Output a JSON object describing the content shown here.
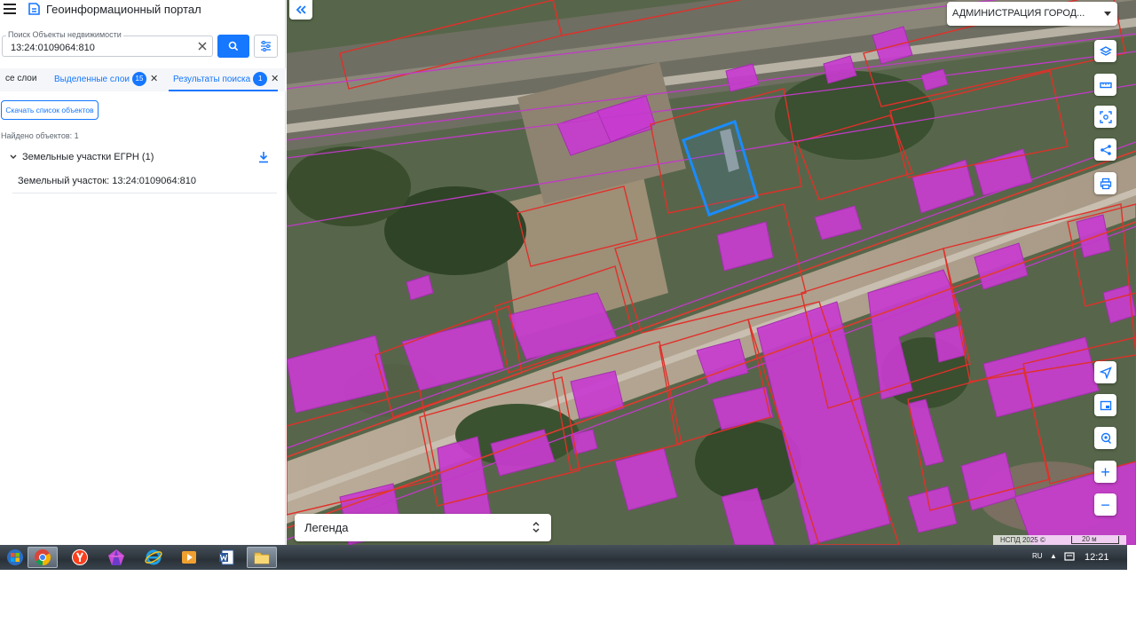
{
  "app": {
    "title": "Геоинформационный портал"
  },
  "search": {
    "label": "Поиск Объекты недвижимости",
    "value": "13:24:0109064:810"
  },
  "tabs": [
    {
      "label": "се слои"
    },
    {
      "label": "Выделенные слои",
      "count": "15"
    },
    {
      "label": "Результаты поиска",
      "count": "1"
    }
  ],
  "results": {
    "download_label": "Скачать список объектов",
    "found_label": "Найдено объектов: 1",
    "group_title": "Земельные участки ЕГРН (1)",
    "items": [
      {
        "label": "Земельный участок: 13:24:0109064:810"
      }
    ]
  },
  "map": {
    "admin_select": "АДМИНИСТРАЦИЯ ГОРОД...",
    "legend_label": "Легенда",
    "attribution": "НСПД 2025 ©",
    "scale_label": "20 м",
    "colors": {
      "building_fill": "#c83ccf",
      "parcel_outline": "#e0302a",
      "selected_parcel": "#1a8cff"
    }
  },
  "taskbar": {
    "apps": [
      "start-orb",
      "chrome-icon",
      "yandex-browser-icon",
      "crystal-app-icon",
      "internet-explorer-icon",
      "media-player-icon",
      "word-icon",
      "file-explorer-icon"
    ],
    "language": "RU",
    "clock": "12:21"
  }
}
